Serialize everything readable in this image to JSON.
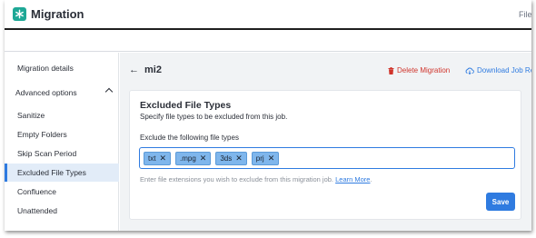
{
  "app": {
    "title": "Migration",
    "top_right_text": "File"
  },
  "sidebar": {
    "items": [
      {
        "label": "Migration details"
      },
      {
        "label": "Advanced options"
      },
      {
        "label": "Sanitize"
      },
      {
        "label": "Empty Folders"
      },
      {
        "label": "Skip Scan Period"
      },
      {
        "label": "Excluded File Types",
        "active": true
      },
      {
        "label": "Confluence"
      },
      {
        "label": "Unattended"
      }
    ]
  },
  "header": {
    "back_glyph": "←",
    "job_name": "mi2",
    "delete_label": "Delete Migration",
    "download_label": "Download Job Report"
  },
  "card": {
    "title": "Excluded File Types",
    "subtitle": "Specify file types to be excluded from this job.",
    "field_label": "Exclude the following file types",
    "tags": [
      "txt",
      ".mpg",
      "3ds",
      "prj"
    ],
    "tag_remove_glyph": "✕",
    "hint": "Enter file extensions you wish to exclude from this migration job.",
    "learn_more": "Learn More",
    "hint_suffix": ".",
    "save_label": "Save"
  },
  "colors": {
    "accent": "#2f7be0",
    "danger": "#d0342c",
    "brand": "#1ea896",
    "tag_bg": "#7fb6ec"
  },
  "icons": {
    "logo": "asterisk-logo-icon",
    "delete": "trash-icon",
    "download": "cloud-download-icon",
    "back": "arrow-left-icon",
    "expand": "chevron-up-icon"
  }
}
